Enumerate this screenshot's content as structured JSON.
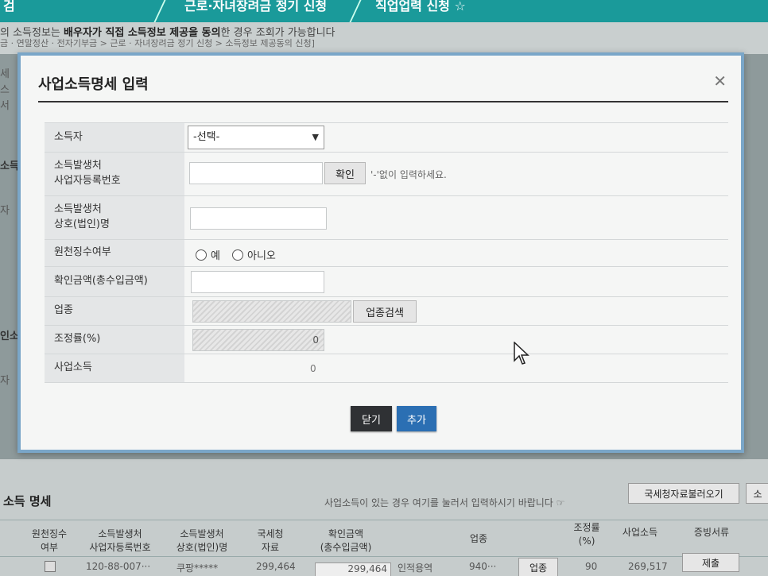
{
  "background": {
    "nav": {
      "item1": "검",
      "item2": "근로·자녀장려금 정기 신청",
      "item3": "직업업력 신청 ☆"
    },
    "notice": {
      "prefix": "의 소득정보는 ",
      "bold": "배우자가 직접 소득정보 제공을 동의",
      "suffix": "한 경우 조회가 가능합니다"
    },
    "path": "금 · 연말정산 · 전자기부금 > 근로 · 자녀장려금 정기 신청 > 소득정보 제공동의 신청]",
    "side_labels": [
      "세",
      "스",
      "서",
      "소득",
      "자",
      "인소",
      "자"
    ],
    "section_title": "소득 명세",
    "section_hint": "사업소득이 있는 경우 여기를 눌러서 입력하시기 바랍니다 ☞",
    "nts_button": "국세청자료불러오기",
    "nts_button_partial": "소",
    "table_headers": [
      "원천징수\n여부",
      "소득발생처\n사업자등록번호",
      "소득발생처\n상호(법인)명",
      "국세청\n자료",
      "확인금액\n(총수입금액)",
      "업종",
      "조정률\n(%)",
      "사업소득",
      "증빙서류"
    ],
    "row": {
      "bizno": "120-88-007···",
      "name": "쿠팡*****",
      "nts": "299,464",
      "amount": "299,464",
      "category": "인적용역",
      "code": "940···",
      "category_btn": "업종",
      "rate": "90",
      "income": "269,517",
      "submit": "제출"
    }
  },
  "dialog": {
    "title": "사업소득명세 입력",
    "fields": {
      "earner_label": "소득자",
      "earner_value": "-선택-",
      "bizno_label_1": "소득발생처",
      "bizno_label_2": "사업자등록번호",
      "confirm_button": "확인",
      "bizno_hint": "'-'없이 입력하세요.",
      "company_label_1": "소득발생처",
      "company_label_2": "상호(법인)명",
      "withholding_label": "원천징수여부",
      "radio_yes": "예",
      "radio_no": "아니오",
      "amount_label": "확인금액(총수입금액)",
      "category_label": "업종",
      "category_search_button": "업종검색",
      "rate_label": "조정률(%)",
      "rate_value": "0",
      "income_label": "사업소득",
      "income_value": "0"
    },
    "close_button": "닫기",
    "add_button": "추가"
  },
  "colors": {
    "header_teal": "#1a9a9a",
    "add_blue": "#2b6fb3",
    "close_dark": "#2f3134",
    "dialog_border": "#7aa6c8"
  }
}
